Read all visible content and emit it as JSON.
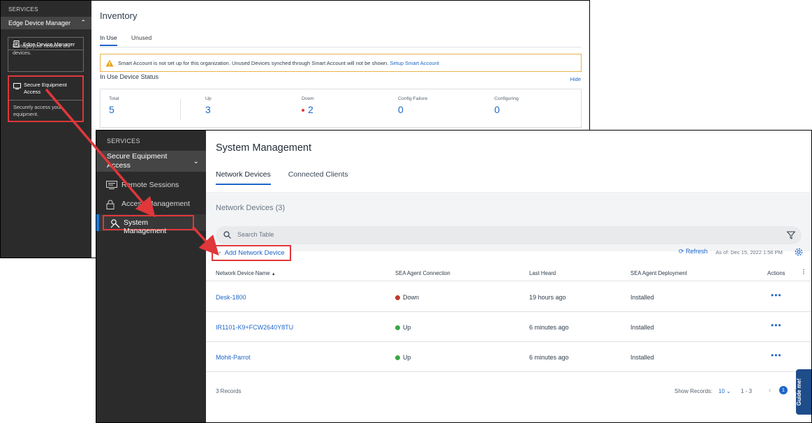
{
  "back": {
    "services_label": "SERVICES",
    "edm_header": "Edge Device Manager",
    "edm_card": {
      "title": "Edge Device Manager",
      "desc": "Manage your network of devices."
    },
    "sea_card": {
      "title": "Secure Equipment Access",
      "desc": "Securely access your equipment."
    },
    "inventory_title": "Inventory",
    "tabs": [
      "In Use",
      "Unused"
    ],
    "warning": {
      "text": "Smart Account is not set up for this organization. Unused Devices synched through Smart Account will not be shown.",
      "link": "Setup Smart Account"
    },
    "status_title": "In Use Device Status",
    "hide_label": "Hide",
    "stats": [
      {
        "label": "Total",
        "value": "5"
      },
      {
        "label": "Up",
        "value": "3"
      },
      {
        "label": "Down",
        "value": "2"
      },
      {
        "label": "Config Failure",
        "value": "0"
      },
      {
        "label": "Configuring",
        "value": "0"
      }
    ]
  },
  "front": {
    "services_label": "SERVICES",
    "sea_header": "Secure Equipment Access",
    "nav": {
      "remote_sessions": "Remote Sessions",
      "access_management": "Access Management",
      "system_management": "System Management"
    },
    "page_title": "System Management",
    "tabs": [
      "Network Devices",
      "Connected Clients"
    ],
    "nd_title": "Network Devices (3)",
    "search_placeholder": "Search Table",
    "add_button": "Add Network Device",
    "refresh": "Refresh",
    "as_of": "As of: Dec 15, 2022 1:56 PM",
    "columns": {
      "name": "Network Device Name",
      "connection": "SEA Agent Connection",
      "last_heard": "Last Heard",
      "deployment": "SEA Agent Deployment",
      "actions": "Actions"
    },
    "rows": [
      {
        "name": "Desk-1800",
        "connection": "Down",
        "last_heard": "19 hours ago",
        "deployment": "Installed"
      },
      {
        "name": "IR1101-K9+FCW2640Y8TU",
        "connection": "Up",
        "last_heard": "6 minutes ago",
        "deployment": "Installed"
      },
      {
        "name": "Mohit-Parrot",
        "connection": "Up",
        "last_heard": "6 minutes ago",
        "deployment": "Installed"
      }
    ],
    "footer": {
      "records": "3 Records",
      "show_records_label": "Show Records:",
      "show_records_value": "10",
      "range": "1 - 3",
      "page": "1"
    },
    "guide": "Guide me!"
  },
  "colors": {
    "accent": "#1e66c9",
    "highlight": "#e0373a",
    "sidebar": "#2b2b2b",
    "down": "#c0392b",
    "up": "#3aa845"
  }
}
